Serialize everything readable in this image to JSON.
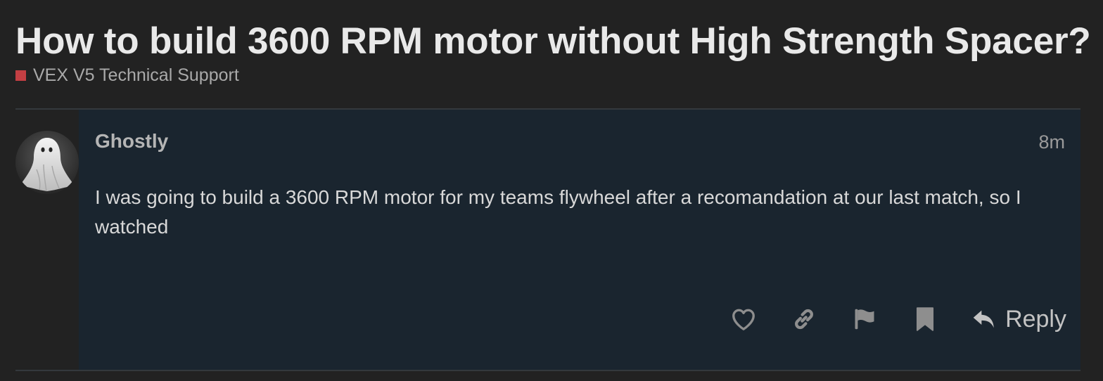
{
  "topic": {
    "title": "How to build 3600 RPM motor without High Strength Spacer?",
    "category": {
      "name": "VEX V5 Technical Support",
      "color": "#c33f43"
    }
  },
  "post": {
    "username": "Ghostly",
    "date": "8m",
    "avatar_icon": "ghost-avatar",
    "body": "I was going to build a 3600 RPM motor for my teams flywheel after a recomandation at our last match, so I watched",
    "actions": {
      "like_icon": "heart-icon",
      "link_icon": "link-icon",
      "flag_icon": "flag-icon",
      "bookmark_icon": "bookmark-icon",
      "reply_icon": "reply-arrow-icon",
      "reply_label": "Reply"
    }
  },
  "colors": {
    "background": "#222222",
    "post_background": "#1a252f",
    "icon": "#8e8e8e"
  }
}
